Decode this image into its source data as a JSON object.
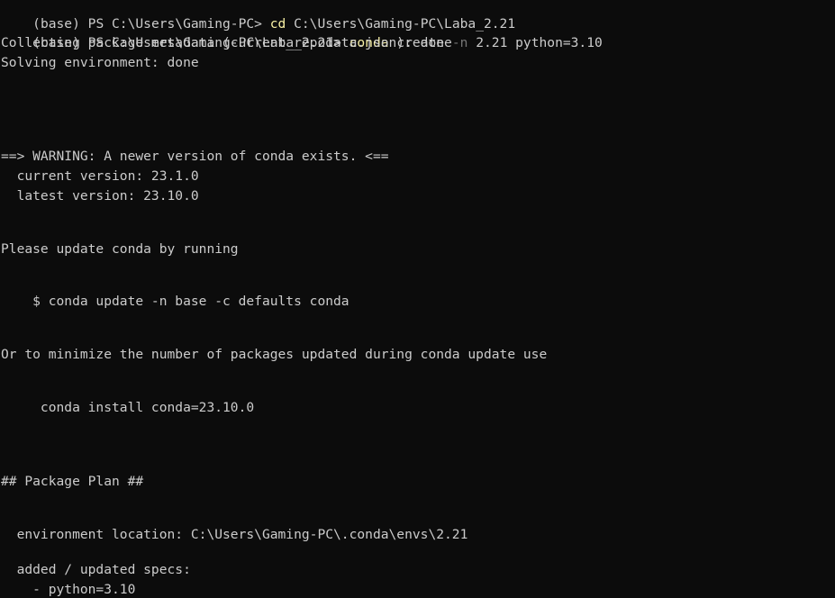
{
  "colors": {
    "background": "#0c0c0c",
    "text": "#cccccc",
    "command": "#f9f1a5",
    "parameter": "#767676"
  },
  "terminal": {
    "line1": {
      "prompt": "(base) PS C:\\Users\\Gaming-PC> ",
      "cmd": "cd",
      "rest": " C:\\Users\\Gaming-PC\\Laba_2.21"
    },
    "line2": {
      "prompt": "(base) PS C:\\Users\\Gaming-PC\\Laba_2.21> ",
      "cmd": "conda",
      "text1": " create ",
      "param": "-n",
      "text2": " 2.21 python=3.10"
    },
    "line3": "Collecting package metadata (current_repodata.json): done",
    "line4": "Solving environment: done",
    "line6": "==> WARNING: A newer version of conda exists. <==",
    "line7": "  current version: 23.1.0",
    "line8": "  latest version: 23.10.0",
    "line10": "Please update conda by running",
    "line12": "    $ conda update -n base -c defaults conda",
    "line14": "Or to minimize the number of packages updated during conda update use",
    "line16": "     conda install conda=23.10.0",
    "line19": "## Package Plan ##",
    "line21": "  environment location: C:\\Users\\Gaming-PC\\.conda\\envs\\2.21",
    "line23": "  added / updated specs:",
    "line24": "    - python=3.10"
  }
}
